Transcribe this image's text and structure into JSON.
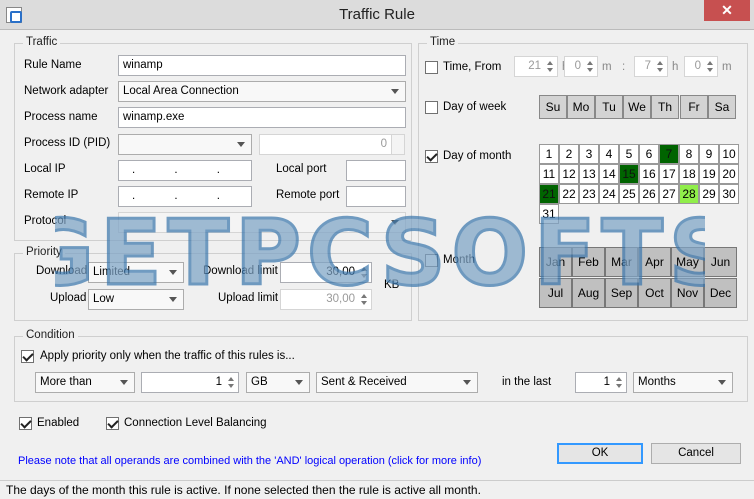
{
  "window": {
    "title": "Traffic Rule",
    "close": "✕"
  },
  "traffic": {
    "legend": "Traffic",
    "rule_name_label": "Rule Name",
    "rule_name": "winamp",
    "adapter_label": "Network adapter",
    "adapter": "Local Area Connection",
    "process_name_label": "Process name",
    "process_name": "winamp.exe",
    "pid_label": "Process ID (PID)",
    "pid_value": "0",
    "local_ip_label": "Local IP",
    "local_ip": ". . .",
    "local_port_label": "Local port",
    "remote_ip_label": "Remote IP",
    "remote_ip": ". . .",
    "remote_port_label": "Remote port",
    "protocol_label": "Protocol"
  },
  "priority": {
    "legend": "Priority",
    "download_label": "Download",
    "download_value": "Limited",
    "upload_label": "Upload",
    "upload_value": "Low",
    "download_limit_label": "Download limit",
    "download_limit": "30,00",
    "upload_limit_label": "Upload limit",
    "upload_limit": "30,00",
    "unit": "KB"
  },
  "time": {
    "legend": "Time",
    "time_from_label": "Time, From",
    "from_h": "21",
    "from_m": "0",
    "to_h": "7",
    "to_m": "0",
    "h": "h",
    "m": "m",
    "colon": ":",
    "day_of_week_label": "Day of week",
    "days": [
      "Su",
      "Mo",
      "Tu",
      "We",
      "Th",
      "Fr",
      "Sa"
    ],
    "day_of_month_label": "Day of month",
    "month_days": [
      "1",
      "2",
      "3",
      "4",
      "5",
      "6",
      "7",
      "8",
      "9",
      "10",
      "11",
      "12",
      "13",
      "14",
      "15",
      "16",
      "17",
      "18",
      "19",
      "20",
      "21",
      "22",
      "23",
      "24",
      "25",
      "26",
      "27",
      "28",
      "29",
      "30",
      "31"
    ],
    "month_label": "Month",
    "months": [
      "Jan",
      "Feb",
      "Mar",
      "Apr",
      "May",
      "Jun",
      "Jul",
      "Aug",
      "Sep",
      "Oct",
      "Nov",
      "Dec"
    ]
  },
  "condition": {
    "legend": "Condition",
    "apply_label": "Apply priority only when the traffic of this rules is...",
    "op": "More than",
    "amount": "1",
    "unit": "GB",
    "direction": "Sent & Received",
    "in_the_last_label": "in the last",
    "period": "1",
    "period_unit": "Months"
  },
  "footer": {
    "enabled_label": "Enabled",
    "clb_label": "Connection Level Balancing",
    "note": "Please note that all operands are combined with the 'AND' logical operation (click for more info)",
    "ok": "OK",
    "cancel": "Cancel",
    "status": "The days of the month this rule is active. If none selected then the rule is active all month."
  },
  "watermark": "GETPCSOFTS",
  "colors": {
    "selected_day": "#006400",
    "highlight_day": "#90ee4a",
    "note_link": "#0000ff"
  }
}
